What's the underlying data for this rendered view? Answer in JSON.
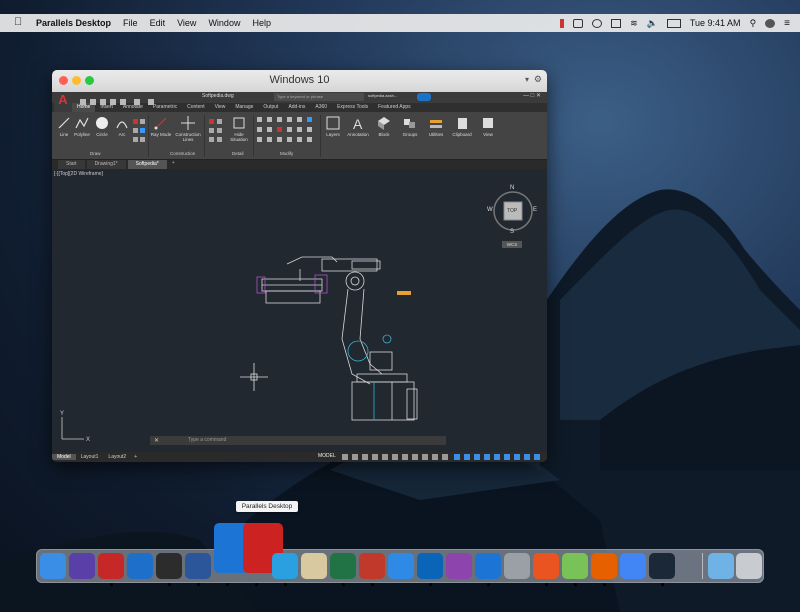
{
  "menubar": {
    "app_name": "Parallels Desktop",
    "menus": [
      "File",
      "Edit",
      "View",
      "Window",
      "Help"
    ],
    "clock": "Tue 9:41 AM"
  },
  "window": {
    "title": "Windows 10",
    "autocad": {
      "file_tab": "Softpedia.dwg",
      "search_placeholder": "Type a keyword or phrase",
      "user": "softpedia.acsh...",
      "ribbon_tabs": [
        "Home",
        "Insert",
        "Annotate",
        "Parametric",
        "Content",
        "View",
        "Manage",
        "Output",
        "Add-ins",
        "A360",
        "Express Tools",
        "Featured Apps"
      ],
      "active_ribbon_tab": "Home",
      "tools": [
        "Line",
        "Polyline",
        "Circle",
        "Arc",
        "Ray Mode",
        "Construction Lines",
        "Hide Situation",
        "Layers",
        "Annotation",
        "Block",
        "Groups",
        "Utilities",
        "Clipboard",
        "View"
      ],
      "panels": [
        "Draw",
        "Construction",
        "Detail",
        "Modify"
      ],
      "file_tabs": [
        "Start",
        "Drawing1*",
        "Softpedia*"
      ],
      "active_file_tab": "Softpedia*",
      "viewport_label": "[-][Top][2D Wireframe]",
      "viewcube": {
        "top": "TOP",
        "n": "N",
        "s": "S",
        "e": "E",
        "w": "W",
        "wcs": "WCS"
      },
      "command_placeholder": "Type a command",
      "layout_tabs": [
        "Model",
        "Layout1",
        "Layout2"
      ],
      "status_model": "MODEL"
    }
  },
  "tooltip": "Parallels Desktop",
  "dock_apps": [
    {
      "name": "finder-icon",
      "color": "#3a8ee6"
    },
    {
      "name": "siri-icon",
      "color": "#5b3fa8"
    },
    {
      "name": "autocad-icon",
      "color": "#c62828"
    },
    {
      "name": "ie-icon",
      "color": "#1e6fc9"
    },
    {
      "name": "inkscape-icon",
      "color": "#2c2c2c"
    },
    {
      "name": "word-icon",
      "color": "#2b579a"
    },
    {
      "name": "windows-icon",
      "color": "#1c74d4"
    },
    {
      "name": "parallels-icon",
      "color": "#cc2222"
    },
    {
      "name": "internet-explorer-icon",
      "color": "#2aa0e0"
    },
    {
      "name": "preview-icon",
      "color": "#d8c9a0"
    },
    {
      "name": "excel-icon",
      "color": "#217346"
    },
    {
      "name": "sketchup-icon",
      "color": "#c0392b"
    },
    {
      "name": "safari-icon",
      "color": "#2f8ae6"
    },
    {
      "name": "outlook-icon",
      "color": "#0a64b8"
    },
    {
      "name": "photos-icon",
      "color": "#8e44ad"
    },
    {
      "name": "windows-start-icon",
      "color": "#1c74d4"
    },
    {
      "name": "apple-icon",
      "color": "#9aa0a6"
    },
    {
      "name": "ubuntu-icon",
      "color": "#e95420"
    },
    {
      "name": "android-icon",
      "color": "#78c257"
    },
    {
      "name": "firefox-icon",
      "color": "#e66000"
    },
    {
      "name": "chrome-icon",
      "color": "#4285f4"
    },
    {
      "name": "steam-icon",
      "color": "#1b2838"
    },
    {
      "name": "folder-icon",
      "color": "#6fb3e6"
    },
    {
      "name": "trash-icon",
      "color": "#c8ccd0"
    }
  ]
}
